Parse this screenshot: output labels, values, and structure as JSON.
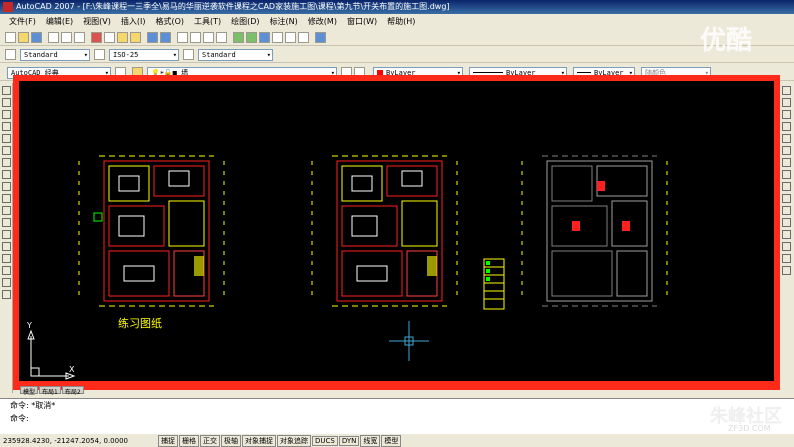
{
  "window": {
    "title": "AutoCAD 2007 - [F:\\朱峰课程一三季全\\易马的华丽逆袭软件课程之CAD家装施工图\\课程\\第九节\\开关布置的施工图.dwg]"
  },
  "menu": [
    "文件(F)",
    "编辑(E)",
    "视图(V)",
    "插入(I)",
    "格式(O)",
    "工具(T)",
    "绘图(D)",
    "标注(N)",
    "修改(M)",
    "窗口(W)",
    "帮助(H)"
  ],
  "styles": {
    "text_style": "Standard",
    "dim_style": "ISO-25",
    "table_style": "Standard"
  },
  "workspace": "AutoCAD 经典",
  "layer": "墙",
  "properties": {
    "color": "ByLayer",
    "linetype": "ByLayer",
    "lineweight": "ByLayer",
    "plotstyle": "随颜色"
  },
  "layout_tabs": [
    "模型",
    "布局1",
    "布局2"
  ],
  "canvas": {
    "label": "练习图纸",
    "axis_x": "X",
    "axis_y": "Y"
  },
  "command": {
    "line1": "命令: *取消*",
    "line2": "命令:"
  },
  "status": {
    "coords": "235928.4230, -21247.2054, 0.0000",
    "buttons": [
      "捕捉",
      "栅格",
      "正交",
      "极轴",
      "对象捕捉",
      "对象追踪",
      "DUCS",
      "DYN",
      "线宽",
      "模型"
    ]
  },
  "watermarks": {
    "top": "优酷",
    "bottom": "朱峰社区",
    "bottom_url": "ZF3D.COM"
  },
  "colors": {
    "canvas_border": "#ff2a1a",
    "canvas_bg": "#000000",
    "title_bg": "#0a246a"
  }
}
